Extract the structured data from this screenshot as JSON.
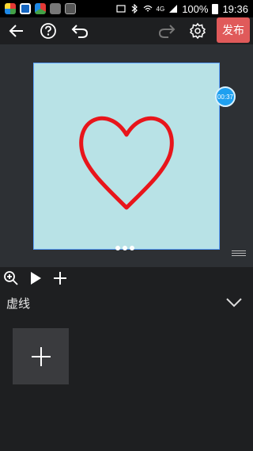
{
  "status_bar": {
    "battery": "100%",
    "time": "19:36",
    "network": "4G",
    "app_icons": [
      "app-icon-1",
      "app-icon-2",
      "app-icon-3",
      "gallery-icon",
      "keyboard-icon"
    ]
  },
  "toolbar": {
    "publish_label": "发布"
  },
  "canvas": {
    "background_color": "#b8e2e6",
    "shape": "heart",
    "stroke_color": "#e8151b",
    "timer_label": "00:37"
  },
  "properties": {
    "section_label": "虚线"
  },
  "colors": {
    "accent_publish": "#e05a5a",
    "timer_badge": "#1ea0f0"
  }
}
